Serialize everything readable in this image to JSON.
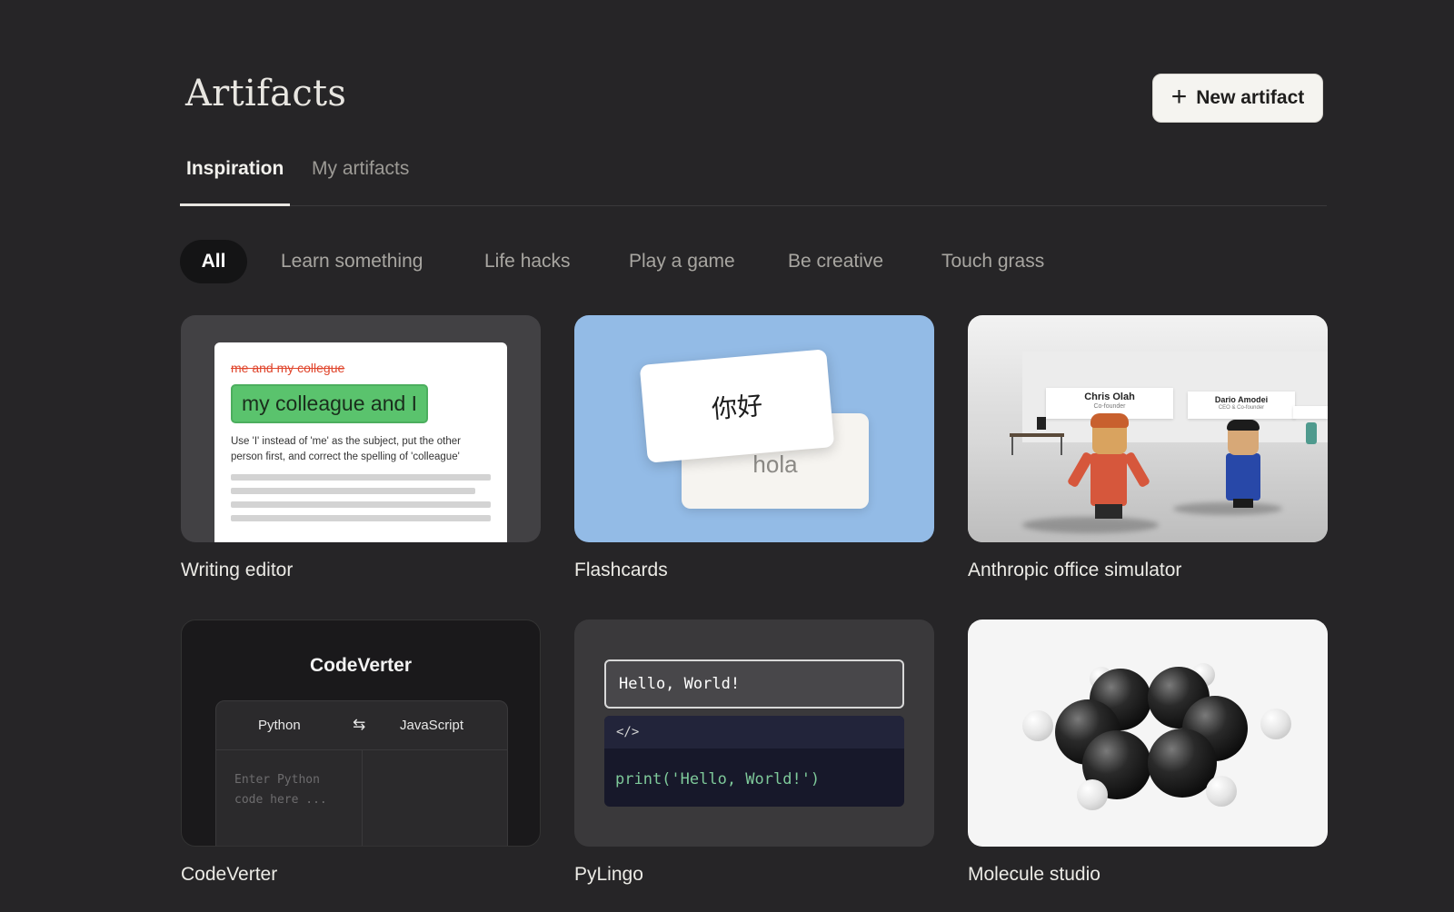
{
  "page": {
    "title": "Artifacts",
    "new_button_label": "New artifact"
  },
  "tabs": [
    {
      "label": "Inspiration",
      "active": true
    },
    {
      "label": "My artifacts",
      "active": false
    }
  ],
  "filters": [
    {
      "label": "All",
      "active": true
    },
    {
      "label": "Learn something"
    },
    {
      "label": "Life hacks"
    },
    {
      "label": "Play a game"
    },
    {
      "label": "Be creative"
    },
    {
      "label": "Touch grass"
    }
  ],
  "cards": [
    {
      "label": "Writing editor",
      "preview": {
        "strikethrough": "me and my collegue",
        "highlight": "my colleague and I",
        "hint": "Use 'I' instead of 'me' as the subject, put the other person first, and correct the spelling of 'colleague'"
      }
    },
    {
      "label": "Flashcards",
      "preview": {
        "front": "你好",
        "back": "hola"
      }
    },
    {
      "label": "Anthropic office simulator",
      "preview": {
        "person1_name": "Chris Olah",
        "person1_role": "Co-founder",
        "person2_name": "Dario Amodei",
        "person2_role": "CEO & Co-founder"
      }
    },
    {
      "label": "CodeVerter",
      "preview": {
        "title": "CodeVerter",
        "from": "Python",
        "to": "JavaScript",
        "swap_icon": "⇆",
        "placeholder": "Enter Python code here ..."
      }
    },
    {
      "label": "PyLingo",
      "preview": {
        "input": "Hello, World!",
        "code_header": "</>",
        "code": "print('Hello, World!')"
      }
    },
    {
      "label": "Molecule studio"
    }
  ],
  "colors": {
    "background": "#262527",
    "accent_green": "#5ac36d",
    "flashcard_bg": "#93bbe6"
  }
}
